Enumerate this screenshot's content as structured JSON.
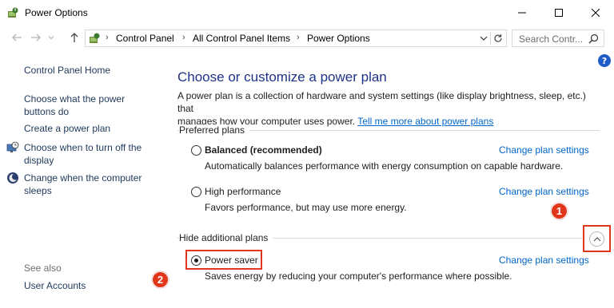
{
  "window": {
    "title": "Power Options",
    "controls": {
      "minimize": "minimize-icon",
      "maximize": "maximize-icon",
      "close": "close-icon"
    }
  },
  "address_bar": {
    "breadcrumbs": [
      "Control Panel",
      "All Control Panel Items",
      "Power Options"
    ],
    "search_placeholder": "Search Contr..."
  },
  "help_label": "?",
  "sidebar": {
    "home": "Control Panel Home",
    "links": [
      {
        "label_line1": "Choose what the power",
        "label_line2": "buttons do",
        "icon": ""
      },
      {
        "label_line1": "Create a power plan",
        "label_line2": "",
        "icon": ""
      },
      {
        "label_line1": "Choose when to turn off the",
        "label_line2": "display",
        "icon": "clock-monitor-icon"
      },
      {
        "label_line1": "Change when the computer",
        "label_line2": "sleeps",
        "icon": "moon-icon"
      }
    ],
    "see_also_heading": "See also",
    "see_also_links": [
      "User Accounts"
    ]
  },
  "main": {
    "title": "Choose or customize a power plan",
    "description_line1": "A power plan is a collection of hardware and system settings (like display brightness, sleep, etc.) that",
    "description_line2_prefix": "manages how your computer uses power. ",
    "description_link": "Tell me more about power plans",
    "preferred_label": "Preferred plans",
    "hidden_label": "Hide additional plans",
    "change_label": "Change plan settings",
    "plans": [
      {
        "name": "Balanced (recommended)",
        "desc": "Automatically balances performance with energy consumption on capable hardware.",
        "selected": false
      },
      {
        "name": "High performance",
        "desc": "Favors performance, but may use more energy.",
        "selected": false
      },
      {
        "name": "Power saver",
        "desc": "Saves energy by reducing your computer's performance where possible.",
        "selected": true
      }
    ]
  },
  "annotations": {
    "marker1": "1",
    "marker2": "2",
    "color": "#e2361b"
  },
  "colors": {
    "link": "#0066cc",
    "title": "#1e3287",
    "sidebar_link": "#1e395b",
    "help": "#1f5bc8"
  }
}
